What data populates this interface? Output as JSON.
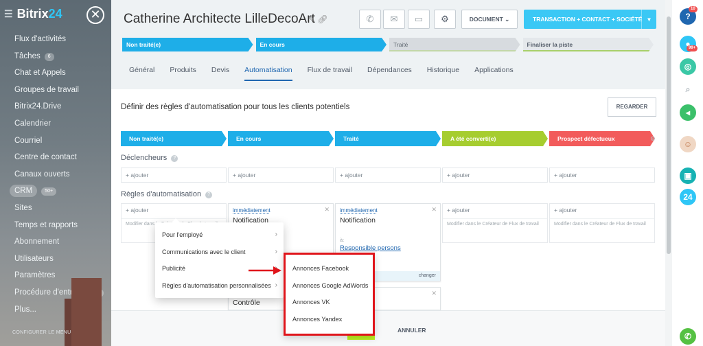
{
  "sidebar": {
    "logo_text": "Bitrix",
    "logo_num": "24",
    "close_glyph": "✕",
    "items": [
      {
        "label": "Flux d'activités"
      },
      {
        "label": "Tâches",
        "badge": "6"
      },
      {
        "label": "Chat et Appels"
      },
      {
        "label": "Groupes de travail"
      },
      {
        "label": "Bitrix24.Drive"
      },
      {
        "label": "Calendrier"
      },
      {
        "label": "Courriel"
      },
      {
        "label": "Centre de contact"
      },
      {
        "label": "Canaux ouverts"
      },
      {
        "label": "CRM",
        "badge": "50+"
      },
      {
        "label": "Sites"
      },
      {
        "label": "Temps et rapports"
      },
      {
        "label": "Abonnement"
      },
      {
        "label": "Utilisateurs"
      },
      {
        "label": "Paramètres"
      },
      {
        "label": "Procédure d'entrepr...",
        "badge": "2"
      },
      {
        "label": "Plus..."
      }
    ],
    "footer": "CONFIGURER LE MENU"
  },
  "header": {
    "title": "Catherine Architecte LilleDecoArt",
    "document_label": "DOCUMENT",
    "transaction_label": "TRANSACTION + CONTACT + SOCIÉTÉ"
  },
  "pipeline": [
    "Non traité(e)",
    "En cours",
    "Traité",
    "Finaliser la piste"
  ],
  "tabs": [
    {
      "label": "Général"
    },
    {
      "label": "Produits"
    },
    {
      "label": "Devis"
    },
    {
      "label": "Automatisation",
      "active": true
    },
    {
      "label": "Flux de travail"
    },
    {
      "label": "Dépendances"
    },
    {
      "label": "Historique"
    },
    {
      "label": "Applications"
    }
  ],
  "automation": {
    "intro": "Définir des règles d'automatisation pour tous les clients potentiels",
    "regarder": "REGARDER",
    "stages": [
      "Non traité(e)",
      "En cours",
      "Traité",
      "A été converti(e)",
      "Prospect défectueux"
    ],
    "triggers_title": "Déclencheurs",
    "rules_title": "Règles d'automatisation",
    "add_label": "+ ajouter",
    "modify_desc": "Modifier dans le Créateur de Flux de travail",
    "rule_immediate": "immédiatement",
    "rule_notification": "Notification",
    "rule_resp_label": "à:",
    "rule_responsible": "Responsible persons",
    "rule_change": "changer",
    "rule_control": "Contrôle",
    "annuler": "ANNULER"
  },
  "context_menu": {
    "items": [
      {
        "label": "Pour l'employé"
      },
      {
        "label": "Communications avec le client"
      },
      {
        "label": "Publicité"
      },
      {
        "label": "Règles d'automatisation personnalisées"
      }
    ],
    "submenu": [
      "Annonces Facebook",
      "Annonces Google AdWords",
      "Annonces VK",
      "Annonces Yandex"
    ]
  },
  "rail": {
    "help_badge": "10",
    "notif_badge": "99+",
    "b24_label": "24"
  },
  "colors": {
    "accent_blue": "#1eaee8",
    "transaction_blue": "#3bc8f5",
    "converted_green": "#a6cd2f",
    "defect_red": "#f25b5b",
    "highlight_red": "#e0151b"
  }
}
